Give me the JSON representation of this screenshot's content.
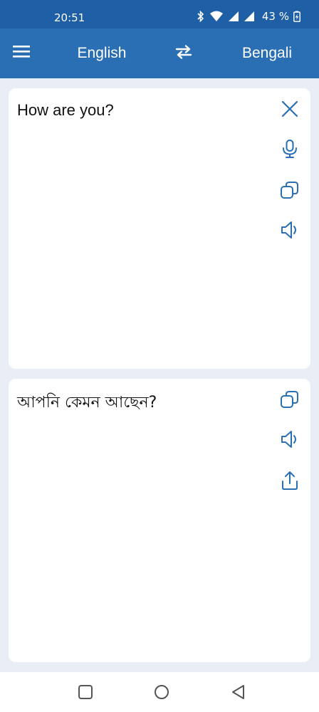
{
  "status_bar": {
    "time": "20:51",
    "battery": "43 %"
  },
  "app_bar": {
    "menu_icon": "hamburger-menu-icon",
    "source_language": "English",
    "swap_icon": "swap-arrows-icon",
    "target_language": "Bengali"
  },
  "input_card": {
    "text": "How are you?",
    "actions": [
      "clear-icon",
      "microphone-icon",
      "copy-icon",
      "speaker-icon"
    ]
  },
  "output_card": {
    "text": "আপনি কেমন আছেন?",
    "actions": [
      "copy-icon",
      "speaker-icon",
      "share-icon"
    ]
  },
  "navigation": {
    "buttons": [
      "recents-square-icon",
      "home-circle-icon",
      "back-triangle-icon"
    ]
  },
  "colors": {
    "status_bar": "#1f5fa6",
    "app_bar": "#2a6fb3",
    "background": "#e9edf6",
    "icon_accent": "#2a6fb3"
  }
}
